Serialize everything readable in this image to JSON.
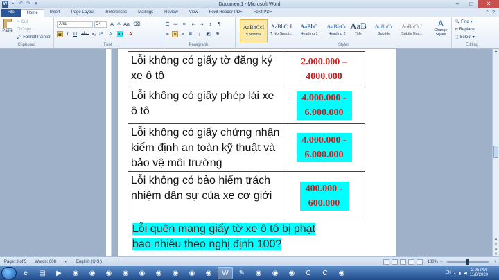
{
  "window": {
    "title": "Document1 - Microsoft Word",
    "controls": [
      "–",
      "□",
      "✕"
    ]
  },
  "tabs": [
    "File",
    "Home",
    "Insert",
    "Page Layout",
    "References",
    "Mailings",
    "Review",
    "View",
    "Foxit Reader PDF",
    "Foxit PDF"
  ],
  "ribbon": {
    "clipboard": {
      "paste": "Paste",
      "cut": "Cut",
      "copy": "Copy",
      "format_painter": "Format Painter",
      "label": "Clipboard"
    },
    "font": {
      "font_name": "Arial",
      "font_size": "24",
      "label": "Font"
    },
    "paragraph": {
      "label": "Paragraph"
    },
    "styles": {
      "label": "Styles",
      "items": [
        {
          "sample": "AaBbCcI",
          "name": "¶ Normal"
        },
        {
          "sample": "AaBbCcI",
          "name": "¶ No Spaci..."
        },
        {
          "sample": "AaBbC",
          "name": "Heading 1"
        },
        {
          "sample": "AaBbCc",
          "name": "Heading 2"
        },
        {
          "sample": "AaB",
          "name": "Title"
        },
        {
          "sample": "AaBbCc",
          "name": "Subtitle"
        },
        {
          "sample": "AaBbCcI",
          "name": "Subtle Em..."
        }
      ],
      "change_styles": "Change Styles"
    },
    "editing": {
      "find": "Find",
      "replace": "Replace",
      "select": "Select",
      "label": "Editing"
    }
  },
  "document": {
    "rows": [
      {
        "violation": "Lỗi không có giấy tờ đăng ký xe ô tô",
        "fine": "2.000.000 – 4000.000"
      },
      {
        "violation": "Lỗi không có giấy phép lái xe ô tô",
        "fine": "4.000.000 - 6.000.000"
      },
      {
        "violation": "Lỗi không có giấy chứng nhận kiểm định an toàn kỹ thuật và bảo vệ môi trường",
        "fine": "4.000.000 - 6.000.000"
      },
      {
        "violation": "Lỗi không có bảo hiểm trách nhiệm dân sự của xe cơ giới",
        "fine": "400.000 - 600.000"
      }
    ],
    "highlight_line1": "Lỗi quên mang giấy tờ xe ô tô bị phạt",
    "highlight_line2": "bao nhiêu theo nghị định 100?"
  },
  "statusbar": {
    "page": "Page: 3 of 5",
    "words": "Words: 608",
    "language": "English (U.S.)",
    "zoom": "100%"
  },
  "taskbar": {
    "language": "EN",
    "time": "2:05 PM",
    "date": "11/8/2020"
  }
}
